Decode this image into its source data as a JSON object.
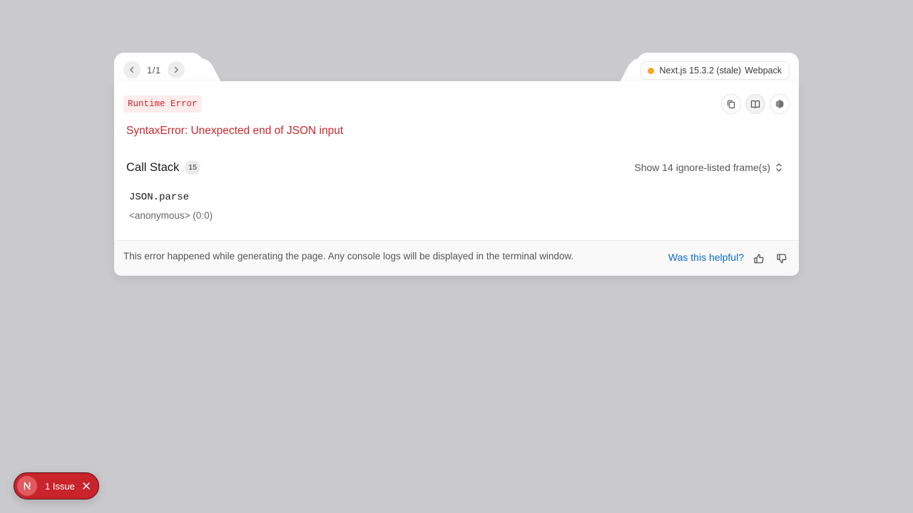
{
  "pager": {
    "text": "1/1"
  },
  "version": {
    "label": "Next.js 15.3.2 (stale)",
    "bundler": "Webpack",
    "status_color": "#f5a623"
  },
  "error": {
    "type": "Runtime Error",
    "message": "SyntaxError: Unexpected end of JSON input"
  },
  "callstack": {
    "title": "Call Stack",
    "count": "15",
    "toggle_label": "Show 14 ignore-listed frame(s)",
    "frames": [
      {
        "function": "JSON.parse",
        "location": "<anonymous> (0:0)"
      }
    ]
  },
  "footer": {
    "note": "This error happened while generating the page. Any console logs will be displayed in the terminal window.",
    "helpful_label": "Was this helpful?"
  },
  "issues": {
    "label": "1 Issue"
  },
  "icons": {
    "prev": "chevron-left-icon",
    "next": "chevron-right-icon",
    "copy": "copy-icon",
    "docs": "book-icon",
    "node": "node-icon",
    "sort": "chevron-up-down-icon",
    "thumbs_up": "thumbs-up-icon",
    "thumbs_down": "thumbs-down-icon",
    "logo": "nextjs-logo-icon",
    "close": "close-icon"
  },
  "colors": {
    "error": "#c9282d",
    "link": "#0a6ccd",
    "pill": "#c9232b",
    "backdrop": "#cacacc"
  }
}
